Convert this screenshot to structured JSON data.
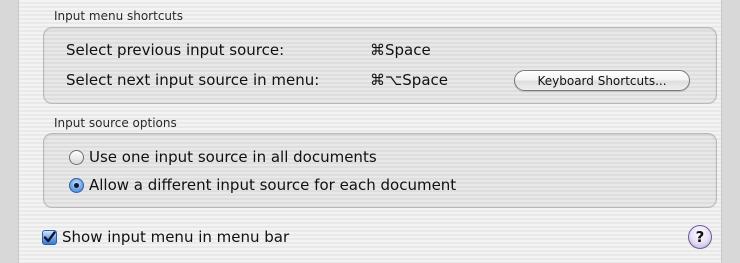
{
  "shortcuts_section": {
    "title": "Input menu shortcuts",
    "rows": [
      {
        "label": "Select previous input source:",
        "shortcut": "⌘Space"
      },
      {
        "label": "Select next input source in menu:",
        "shortcut": "⌘⌥Space"
      }
    ],
    "keyboard_shortcuts_button": "Keyboard Shortcuts..."
  },
  "options_section": {
    "title": "Input source options",
    "options": [
      {
        "label": "Use one input source in all documents",
        "selected": false
      },
      {
        "label": "Allow a different input source for each document",
        "selected": true
      }
    ]
  },
  "show_menu_checkbox": {
    "label": "Show input menu in menu bar",
    "checked": true
  },
  "help_button": {
    "label": "?"
  },
  "colors": {
    "accent": "#3b76c9",
    "help_border": "#6b5a92"
  }
}
